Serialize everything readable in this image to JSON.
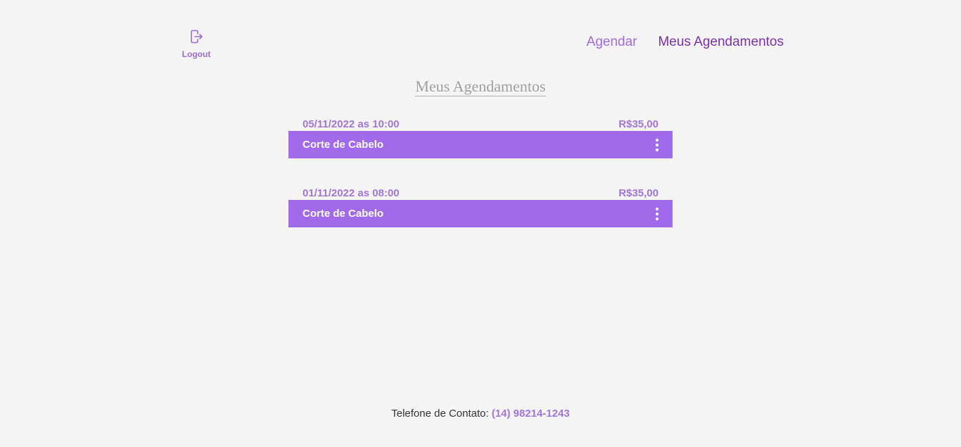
{
  "header": {
    "logout_label": "Logout",
    "nav": {
      "agendar": "Agendar",
      "meus_agendamentos": "Meus Agendamentos"
    }
  },
  "main": {
    "title": "Meus Agendamentos",
    "appointments": [
      {
        "datetime": "05/11/2022 as 10:00",
        "price": "R$35,00",
        "service": "Corte de Cabelo"
      },
      {
        "datetime": "01/11/2022 as 08:00",
        "price": "R$35,00",
        "service": "Corte de Cabelo"
      }
    ]
  },
  "footer": {
    "label": "Telefone de Contato:",
    "phone": "(14) 98214-1243"
  },
  "colors": {
    "accent": "#a06aeb",
    "accent_text": "#a276d9",
    "active_nav": "#7b2fa8",
    "background": "#f4f4f4"
  },
  "icons": {
    "logout": "logout-icon",
    "menu": "kebab-menu-icon"
  }
}
